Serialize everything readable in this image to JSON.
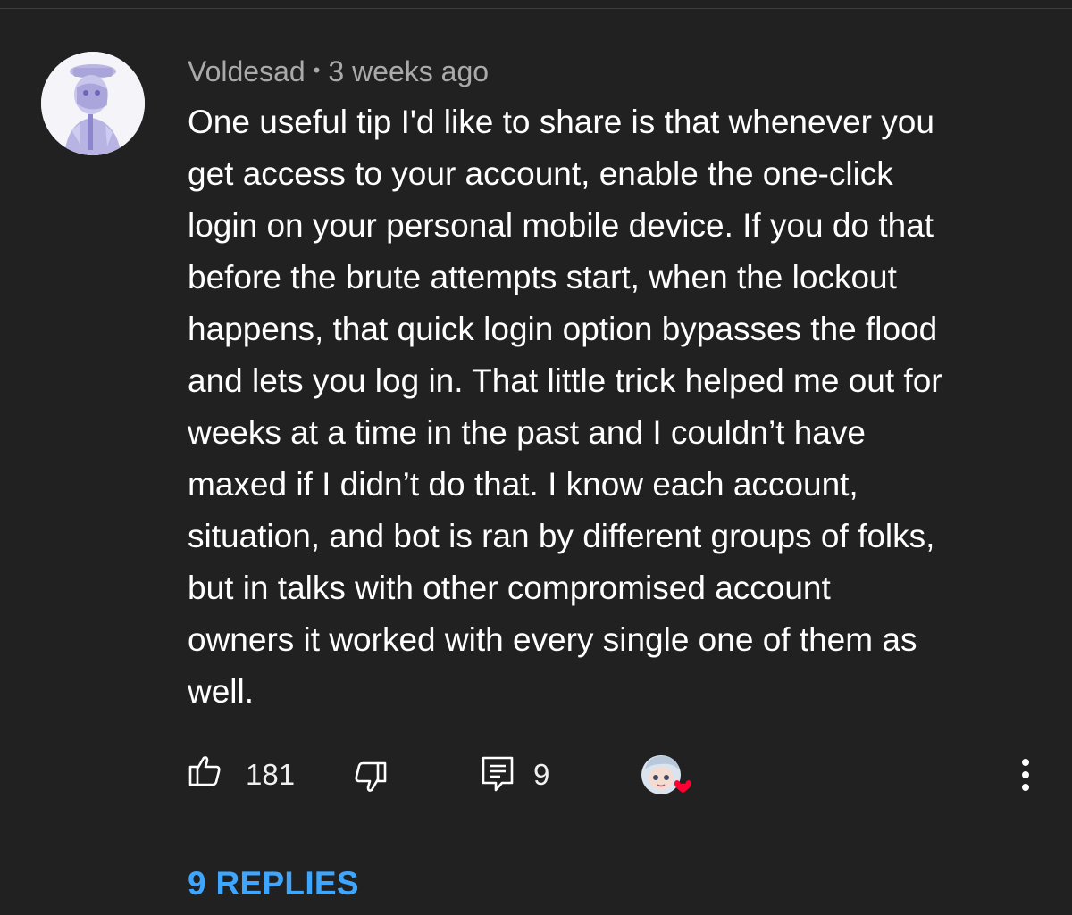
{
  "comment": {
    "author": "Voldesad",
    "separator": "•",
    "timestamp": "3 weeks ago",
    "text": "One useful tip I'd like to share is that whenever you\nget access to your account, enable the one-click\nlogin on your personal mobile device. If you do that\nbefore the brute attempts start, when the lockout\nhappens, that quick login option bypasses the flood\nand lets you log in. That little trick helped me out for\nweeks at a time in the past and I couldn’t have\nmaxed if I didn’t do that. I know each account,\nsituation, and bot is ran by different groups of folks,\nbut in talks with other compromised account\nowners it worked with every single one of them as\nwell."
  },
  "actions": {
    "like_icon": "thumbs-up-icon",
    "like_count": "181",
    "dislike_icon": "thumbs-down-icon",
    "reply_icon": "comment-reply-icon",
    "reply_count": "9",
    "creator_heart_icon": "creator-heart-icon",
    "more_icon": "more-vertical-icon"
  },
  "replies": {
    "label": "9 REPLIES"
  },
  "colors": {
    "background": "#212121",
    "meta_text": "#aaaaaa",
    "link": "#3ea6ff",
    "heart": "#ff0033"
  }
}
